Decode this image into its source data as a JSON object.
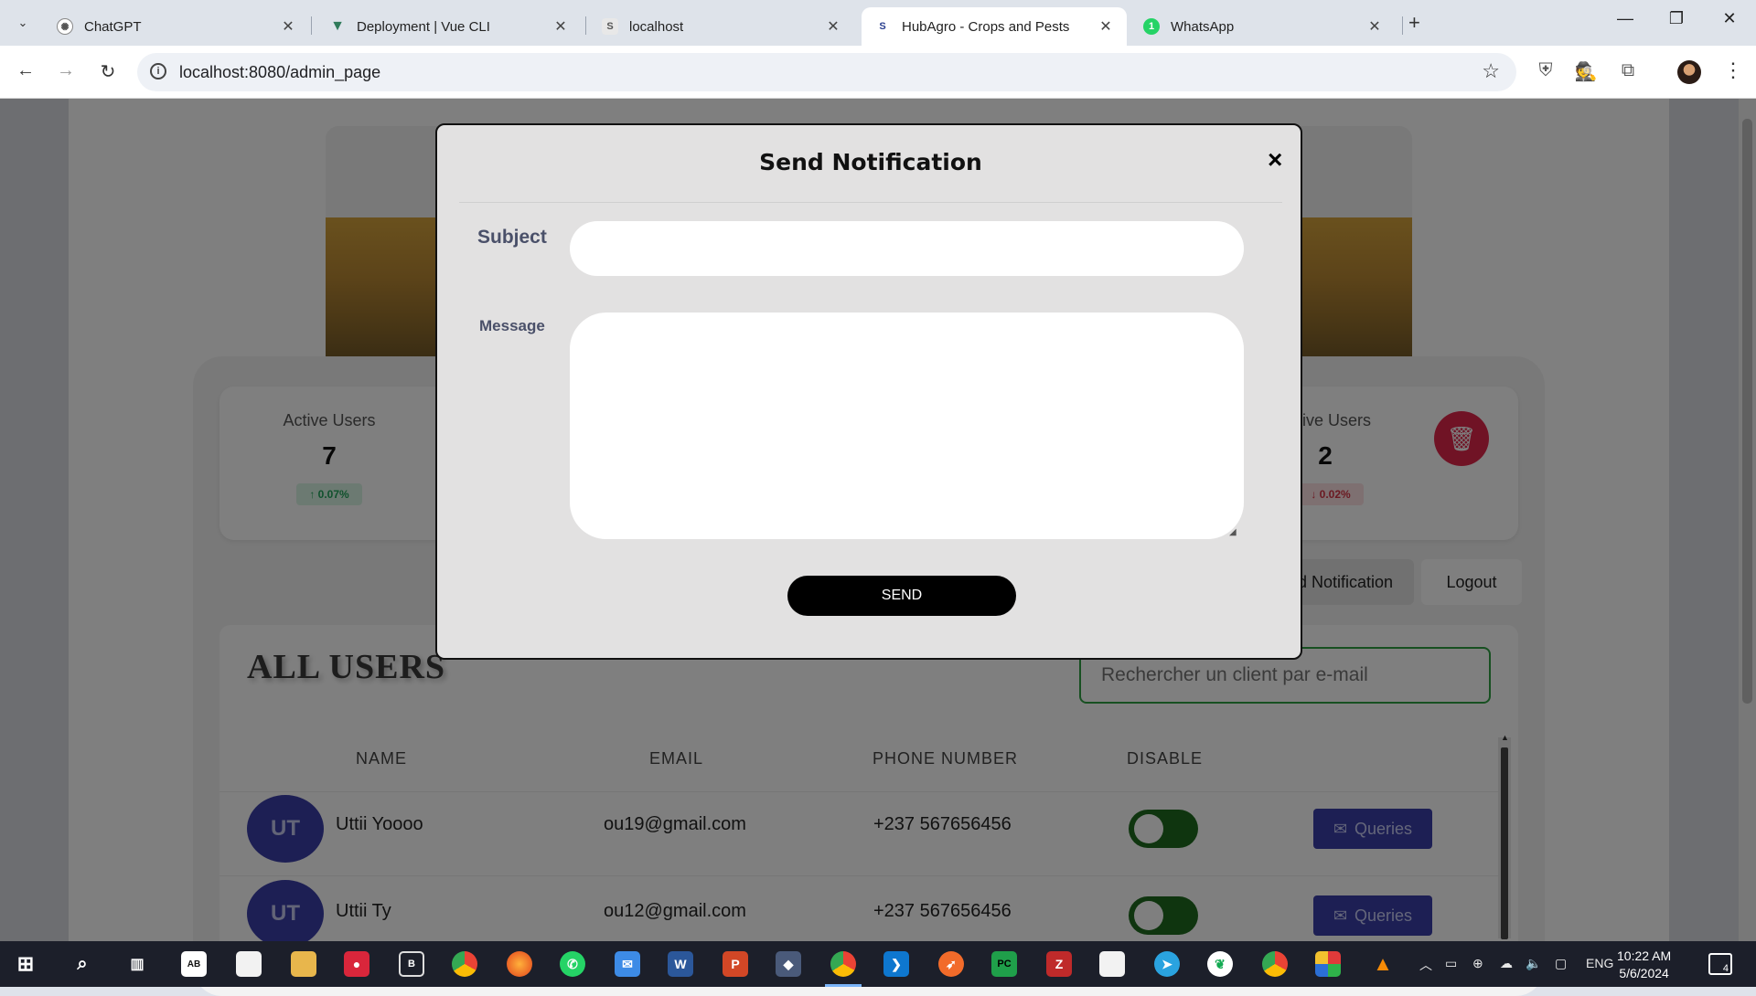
{
  "browser": {
    "tabs": [
      {
        "title": "ChatGPT"
      },
      {
        "title": "Deployment | Vue CLI"
      },
      {
        "title": "localhost"
      },
      {
        "title": "HubAgro - Crops and Pests"
      },
      {
        "title": "WhatsApp"
      }
    ],
    "url": "localhost:8080/admin_page"
  },
  "dashboard": {
    "stats": [
      {
        "label": "Active Users",
        "value": "7",
        "change": "↑ 0.07%"
      },
      {
        "label": "ctive Users",
        "value": "2",
        "change": "↓ 0.02%"
      }
    ],
    "buttons": {
      "notification": "d Notification",
      "logout": "Logout"
    },
    "users_title": "ALL USERS",
    "search_placeholder": "Rechercher un client par e-mail",
    "columns": [
      "NAME",
      "EMAIL",
      "PHONE NUMBER",
      "DISABLE"
    ],
    "rows": [
      {
        "initials": "UT",
        "name": "Uttii Yoooo",
        "email": "ou19@gmail.com",
        "phone": "+237 567656456",
        "action": "Queries"
      },
      {
        "initials": "UT",
        "name": "Uttii Ty",
        "email": "ou12@gmail.com",
        "phone": "+237 567656456",
        "action": "Queries"
      }
    ]
  },
  "modal": {
    "title": "Send Notification",
    "close": "×",
    "subject_label": "Subject",
    "subject_value": "",
    "message_label": "Message",
    "message_value": "",
    "send_label": "SEND"
  },
  "taskbar": {
    "language": "ENG",
    "time": "10:22 AM",
    "date": "5/6/2024",
    "notification_count": "4"
  },
  "colors": {
    "modal_bg": "#e2e1e1",
    "label_color": "#4a5069",
    "send_bg": "#000000",
    "accent_blue": "#3b3ea8",
    "toggle_green": "#1e6b1e",
    "delete_red": "#e0264a",
    "search_border": "#2ea043"
  }
}
